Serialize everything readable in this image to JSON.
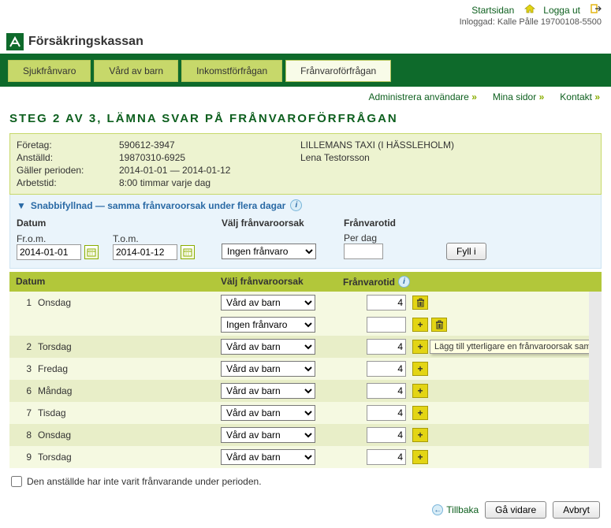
{
  "top": {
    "home": "Startsidan",
    "logout": "Logga ut",
    "logged_in": "Inloggad: Kalle Pålle 19700108-5500"
  },
  "brand": "Försäkringskassan",
  "tabs": [
    "Sjukfrånvaro",
    "Vård av barn",
    "Inkomstförfrågan",
    "Frånvaroförfrågan"
  ],
  "active_tab": 3,
  "subnav": [
    "Administrera användare",
    "Mina sidor",
    "Kontakt"
  ],
  "heading": "Steg 2 av 3, lämna svar på frånvaroförfrågan",
  "info": {
    "labels": {
      "company": "Företag:",
      "employee": "Anställd:",
      "period": "Gäller perioden:",
      "worktime": "Arbetstid:"
    },
    "company_id": "590612-3947",
    "company_name": "LILLEMANS TAXI (I HÄSSLEHOLM)",
    "employee_id": "19870310-6925",
    "employee_name": "Lena Testorsson",
    "period": "2014-01-01 — 2014-01-12",
    "worktime": "8:00 timmar varje dag"
  },
  "quick": {
    "title": "Snabbifyllnad — samma frånvaroorsak under flera dagar",
    "date_label": "Datum",
    "from_label": "Fr.o.m.",
    "to_label": "T.o.m.",
    "from": "2014-01-01",
    "to": "2014-01-12",
    "reason_label": "Välj frånvaroorsak",
    "reason_value": "Ingen frånvaro",
    "time_label": "Frånvarotid",
    "perday_label": "Per dag",
    "perday_value": "",
    "fill_btn": "Fyll i"
  },
  "grid": {
    "headers": {
      "date": "Datum",
      "reason": "Välj frånvaroorsak",
      "time": "Frånvarotid"
    },
    "reason_options": [
      "Vård av barn",
      "Ingen frånvaro"
    ],
    "rows": [
      {
        "num": "1",
        "day": "Onsdag",
        "reason": "Vård av barn",
        "hours": "4",
        "extra": {
          "reason": "Ingen frånvaro",
          "hours": ""
        }
      },
      {
        "num": "2",
        "day": "Torsdag",
        "reason": "Vård av barn",
        "hours": "4",
        "tooltip": "Lägg till ytterligare en frånvaroorsak samma dag."
      },
      {
        "num": "3",
        "day": "Fredag",
        "reason": "Vård av barn",
        "hours": "4"
      },
      {
        "num": "6",
        "day": "Måndag",
        "reason": "Vård av barn",
        "hours": "4"
      },
      {
        "num": "7",
        "day": "Tisdag",
        "reason": "Vård av barn",
        "hours": "4"
      },
      {
        "num": "8",
        "day": "Onsdag",
        "reason": "Vård av barn",
        "hours": "4"
      },
      {
        "num": "9",
        "day": "Torsdag",
        "reason": "Vård av barn",
        "hours": "4"
      }
    ]
  },
  "not_absent_label": "Den anställde har inte varit frånvarande under perioden.",
  "footer": {
    "back": "Tillbaka",
    "next": "Gå vidare",
    "cancel": "Avbryt"
  }
}
